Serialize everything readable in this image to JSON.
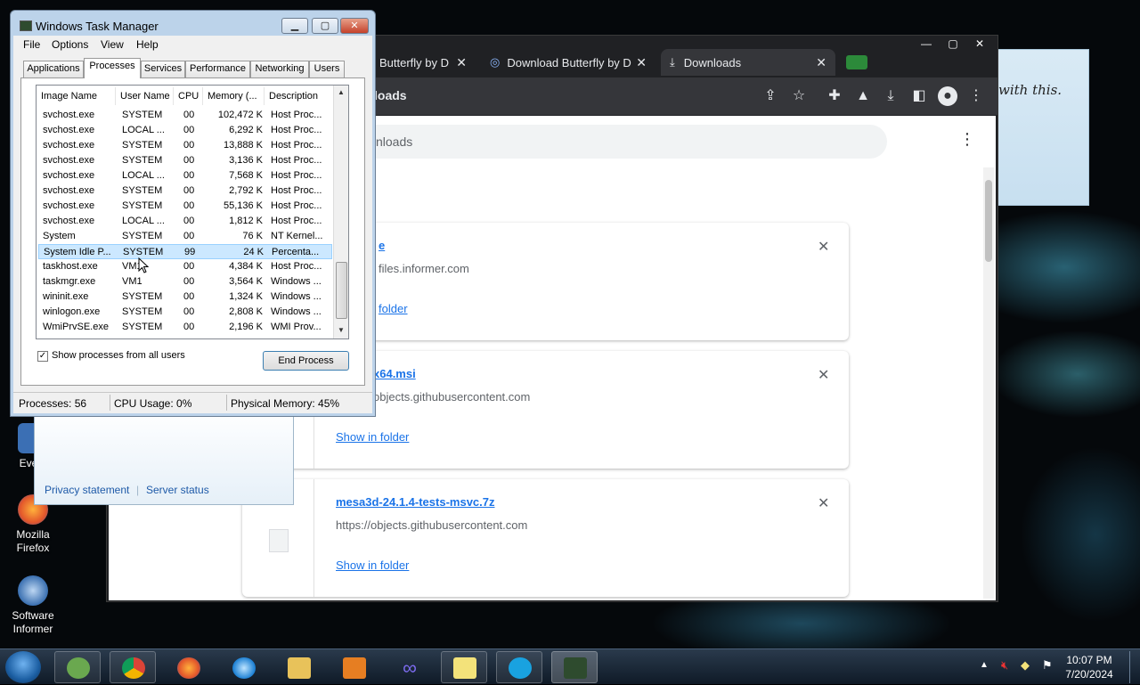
{
  "desktop": {
    "icons": [
      {
        "label": "Every",
        "name": "everything"
      },
      {
        "label": "Mozilla Firefox",
        "name": "firefox"
      },
      {
        "label": "Software Informer",
        "name": "software-informer"
      }
    ],
    "sticky_note": "with this."
  },
  "chrome": {
    "tabs": [
      {
        "label": "Butterfly by D"
      },
      {
        "label": "Download Butterfly by D"
      },
      {
        "label": "Downloads"
      }
    ],
    "page_title": "loads",
    "search_placeholder": "nloads",
    "downloads": [
      {
        "name": "e",
        "url": "files.informer.com",
        "show": "folder"
      },
      {
        "name": "x64.msi",
        "url": "objects.githubusercontent.com",
        "show": "Show in folder"
      },
      {
        "name": "mesa3d-24.1.4-tests-msvc.7z",
        "url": "https://objects.githubusercontent.com",
        "show": "Show in folder"
      }
    ]
  },
  "back_dialog": {
    "privacy": "Privacy statement",
    "server": "Server status"
  },
  "taskmgr": {
    "title": "Windows Task Manager",
    "menu": [
      "File",
      "Options",
      "View",
      "Help"
    ],
    "tabs": [
      "Applications",
      "Processes",
      "Services",
      "Performance",
      "Networking",
      "Users"
    ],
    "columns": [
      "Image Name",
      "User Name",
      "CPU",
      "Memory (...",
      "Description"
    ],
    "processes": [
      {
        "image": "svchost.exe",
        "user": "SYSTEM",
        "cpu": "00",
        "mem": "102,472 K",
        "desc": "Host Proc..."
      },
      {
        "image": "svchost.exe",
        "user": "LOCAL ...",
        "cpu": "00",
        "mem": "6,292 K",
        "desc": "Host Proc..."
      },
      {
        "image": "svchost.exe",
        "user": "SYSTEM",
        "cpu": "00",
        "mem": "13,888 K",
        "desc": "Host Proc..."
      },
      {
        "image": "svchost.exe",
        "user": "SYSTEM",
        "cpu": "00",
        "mem": "3,136 K",
        "desc": "Host Proc..."
      },
      {
        "image": "svchost.exe",
        "user": "LOCAL ...",
        "cpu": "00",
        "mem": "7,568 K",
        "desc": "Host Proc..."
      },
      {
        "image": "svchost.exe",
        "user": "SYSTEM",
        "cpu": "00",
        "mem": "2,792 K",
        "desc": "Host Proc..."
      },
      {
        "image": "svchost.exe",
        "user": "SYSTEM",
        "cpu": "00",
        "mem": "55,136 K",
        "desc": "Host Proc..."
      },
      {
        "image": "svchost.exe",
        "user": "LOCAL ...",
        "cpu": "00",
        "mem": "1,812 K",
        "desc": "Host Proc..."
      },
      {
        "image": "System",
        "user": "SYSTEM",
        "cpu": "00",
        "mem": "76 K",
        "desc": "NT Kernel..."
      },
      {
        "image": "System Idle P...",
        "user": "SYSTEM",
        "cpu": "99",
        "mem": "24 K",
        "desc": "Percenta..."
      },
      {
        "image": "taskhost.exe",
        "user": "VM1",
        "cpu": "00",
        "mem": "4,384 K",
        "desc": "Host Proc..."
      },
      {
        "image": "taskmgr.exe",
        "user": "VM1",
        "cpu": "00",
        "mem": "3,564 K",
        "desc": "Windows ..."
      },
      {
        "image": "wininit.exe",
        "user": "SYSTEM",
        "cpu": "00",
        "mem": "1,324 K",
        "desc": "Windows ..."
      },
      {
        "image": "winlogon.exe",
        "user": "SYSTEM",
        "cpu": "00",
        "mem": "2,808 K",
        "desc": "Windows ..."
      },
      {
        "image": "WmiPrvSE.exe",
        "user": "SYSTEM",
        "cpu": "00",
        "mem": "2,196 K",
        "desc": "WMI Prov..."
      }
    ],
    "selected_index": 9,
    "show_all_label": "Show processes from all users",
    "show_all_checked": "✓",
    "end_process": "End Process",
    "status": {
      "processes": "Processes: 56",
      "cpu": "CPU Usage: 0%",
      "memory": "Physical Memory: 45%"
    }
  },
  "taskbar": {
    "time": "10:07 PM",
    "date": "7/20/2024"
  }
}
